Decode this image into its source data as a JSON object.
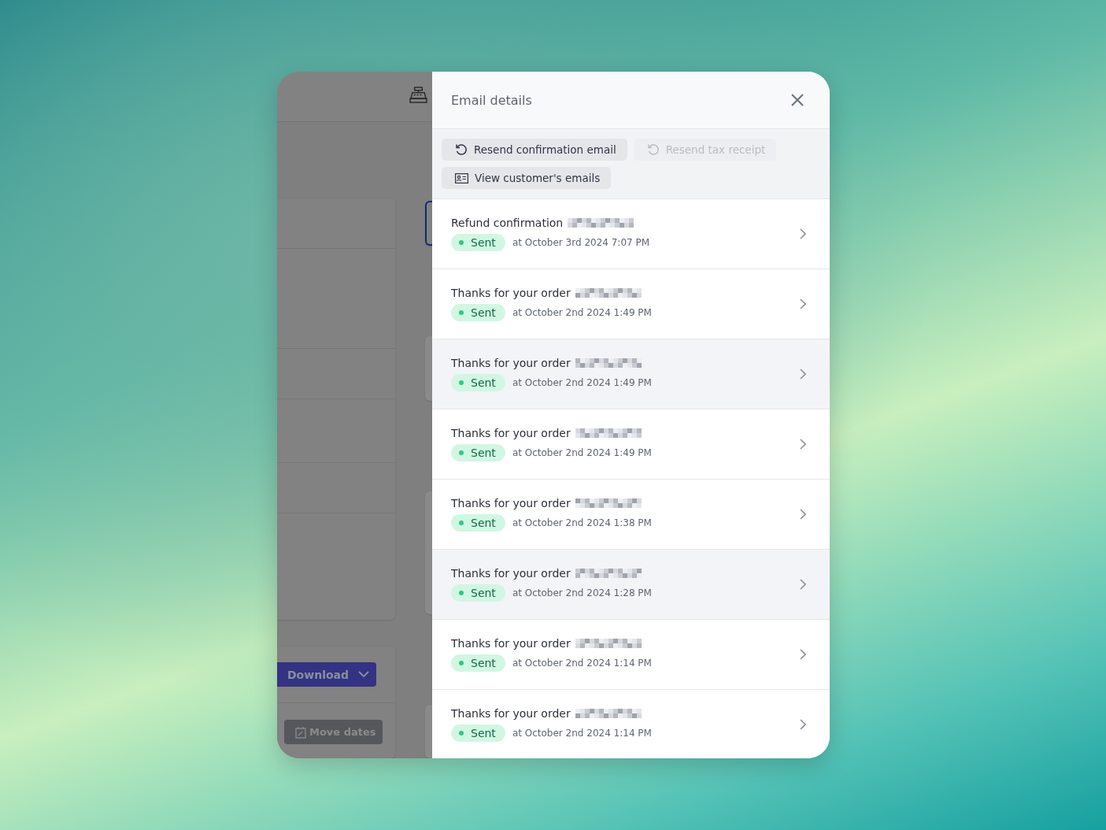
{
  "background_app": {
    "buttons": [
      {
        "label": "Download",
        "kind": "dropdown"
      },
      {
        "label": "Move dates",
        "kind": "calendar"
      }
    ]
  },
  "panel": {
    "title": "Email details",
    "actions": [
      {
        "label": "Resend confirmation email",
        "kind": "resend",
        "disabled": false
      },
      {
        "label": "Resend tax receipt",
        "kind": "resend",
        "disabled": true
      },
      {
        "label": "View customer's emails",
        "kind": "contacts",
        "disabled": false
      }
    ],
    "emails": [
      {
        "subject": "Refund confirmation",
        "status": "Sent",
        "time": "at October 3rd 2024 7:07 PM",
        "highlighted": false
      },
      {
        "subject": "Thanks for your order",
        "status": "Sent",
        "time": "at October 2nd 2024 1:49 PM",
        "highlighted": false
      },
      {
        "subject": "Thanks for your order",
        "status": "Sent",
        "time": "at October 2nd 2024 1:49 PM",
        "highlighted": true
      },
      {
        "subject": "Thanks for your order",
        "status": "Sent",
        "time": "at October 2nd 2024 1:49 PM",
        "highlighted": false
      },
      {
        "subject": "Thanks for your order",
        "status": "Sent",
        "time": "at October 2nd 2024 1:38 PM",
        "highlighted": false
      },
      {
        "subject": "Thanks for your order",
        "status": "Sent",
        "time": "at October 2nd 2024 1:28 PM",
        "highlighted": true
      },
      {
        "subject": "Thanks for your order",
        "status": "Sent",
        "time": "at October 2nd 2024 1:14 PM",
        "highlighted": false
      },
      {
        "subject": "Thanks for your order",
        "status": "Sent",
        "time": "at October 2nd 2024 1:14 PM",
        "highlighted": false
      }
    ]
  }
}
